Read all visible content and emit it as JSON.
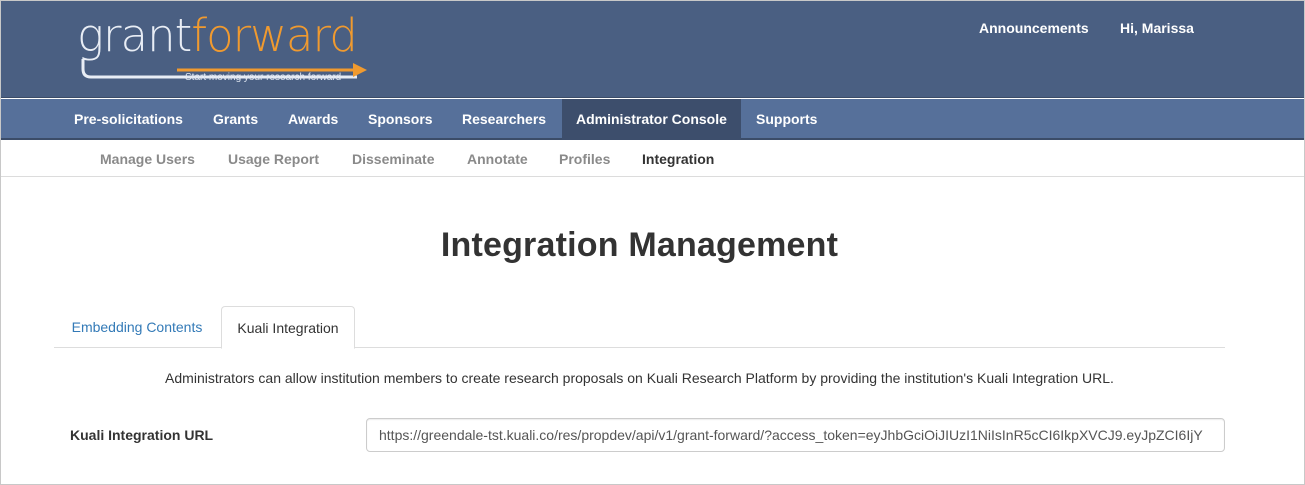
{
  "brand": {
    "name_part1": "grant",
    "name_part2": "forward",
    "tagline": "Start moving your research forward",
    "colors": {
      "header_bg": "#4a5f82",
      "nav_bg": "#56709a",
      "nav_active_bg": "#3d4e6c",
      "accent_orange": "#f09a2f",
      "link_blue": "#337ab7"
    }
  },
  "header": {
    "announcements_label": "Announcements",
    "greeting_label": "Hi, Marissa"
  },
  "main_nav": {
    "items": [
      {
        "label": "Pre-solicitations",
        "active": false
      },
      {
        "label": "Grants",
        "active": false
      },
      {
        "label": "Awards",
        "active": false
      },
      {
        "label": "Sponsors",
        "active": false
      },
      {
        "label": "Researchers",
        "active": false
      },
      {
        "label": "Administrator Console",
        "active": true
      },
      {
        "label": "Supports",
        "active": false
      }
    ]
  },
  "sub_nav": {
    "items": [
      {
        "label": "Manage Users",
        "active": false
      },
      {
        "label": "Usage Report",
        "active": false
      },
      {
        "label": "Disseminate",
        "active": false
      },
      {
        "label": "Annotate",
        "active": false
      },
      {
        "label": "Profiles",
        "active": false
      },
      {
        "label": "Integration",
        "active": true
      }
    ]
  },
  "content": {
    "title": "Integration Management",
    "tabs": [
      {
        "label": "Embedding Contents",
        "active": false
      },
      {
        "label": "Kuali Integration",
        "active": true
      }
    ],
    "description": "Administrators can allow institution members to create research proposals on Kuali Research Platform by providing the institution's Kuali Integration URL.",
    "url_field": {
      "label": "Kuali Integration URL",
      "value": "https://greendale-tst.kuali.co/res/propdev/api/v1/grant-forward/?access_token=eyJhbGciOiJIUzI1NiIsInR5cCI6IkpXVCJ9.eyJpZCI6IjY"
    }
  }
}
